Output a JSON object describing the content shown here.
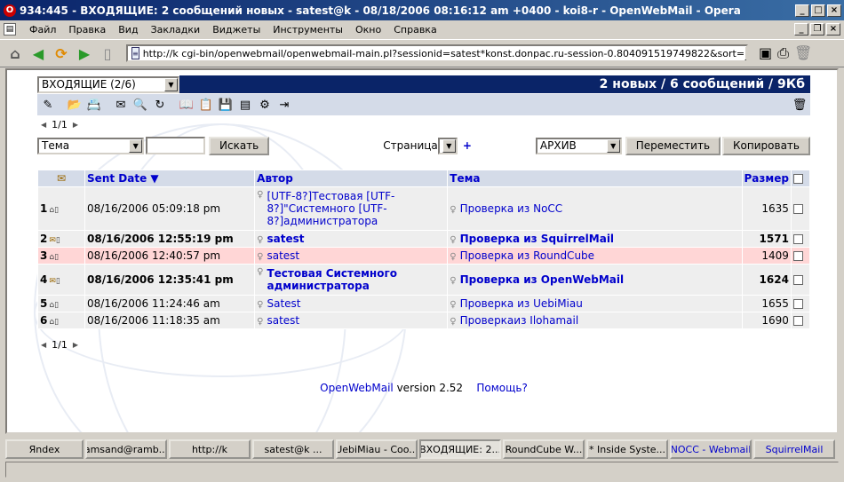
{
  "window": {
    "title": "934:445 - ВХОДЯЩИЕ: 2 сообщений новых - satest@k                    - 08/18/2006 08:16:12 am +0400 - koi8-r - OpenWebMail - Opera"
  },
  "menu": [
    "Файл",
    "Правка",
    "Вид",
    "Закладки",
    "Виджеты",
    "Инструменты",
    "Окно",
    "Справка"
  ],
  "address": {
    "url": "http://k               cgi-bin/openwebmail/openwebmail-main.pl?sessionid=satest*konst.donpac.ru-session-0.804091519749822&sort="
  },
  "folder_select": {
    "value": "ВХОДЯЩИЕ (2/6)"
  },
  "summary": "2 новых / 6 сообщений / 9Кб",
  "pager": {
    "current": "1/1"
  },
  "search": {
    "field": "Тема",
    "query": "",
    "button": "Искать",
    "page_label": "Страница",
    "page_value": "1",
    "plus": "+"
  },
  "move": {
    "folder": "АРХИВ",
    "move_button": "Переместить",
    "copy_button": "Копировать"
  },
  "table": {
    "headers": {
      "date": "Sent Date",
      "author": "Автор",
      "subject": "Тема",
      "size": "Размер"
    },
    "rows": [
      {
        "num": "1",
        "date": "08/16/2006 05:09:18 pm",
        "author": "[UTF-8?]Тестовая [UTF-8?]\"Системного [UTF-8?]администратора",
        "subject": "Проверка из NoCC",
        "size": "1635"
      },
      {
        "num": "2",
        "date": "08/16/2006 12:55:19 pm",
        "author": "satest",
        "subject": "Проверка из SquirrelMail",
        "size": "1571"
      },
      {
        "num": "3",
        "date": "08/16/2006 12:40:57 pm",
        "author": "satest",
        "subject": "Проверка из RoundCube",
        "size": "1409"
      },
      {
        "num": "4",
        "date": "08/16/2006 12:35:41 pm",
        "author": "Тестовая Системного администратора",
        "subject": "Проверка из OpenWebMail",
        "size": "1624"
      },
      {
        "num": "5",
        "date": "08/16/2006 11:24:46 am",
        "author": "Satest",
        "subject": "Проверка из UebiMiau",
        "size": "1655"
      },
      {
        "num": "6",
        "date": "08/16/2006 11:18:35 am",
        "author": "satest",
        "subject": "Проверкаиз Ilohamail",
        "size": "1690"
      }
    ]
  },
  "footer": {
    "app": "OpenWebMail",
    "version": "version 2.52",
    "help": "Помощь?"
  },
  "taskbar": [
    "Яndex",
    "amsand@ramb...",
    "http://k          ",
    "satest@k         ...",
    "UebiMiau - Coo...",
    "ВХОДЯЩИЕ: 2...",
    "RoundCube W...",
    "* Inside Syste...",
    "NOCC - Webmail",
    "SquirrelMail"
  ],
  "colors": {
    "header_bar": "#0a2468",
    "link": "#0000cc",
    "highlight_row": "#ffd6d6",
    "titlebar": "#0a246a"
  }
}
